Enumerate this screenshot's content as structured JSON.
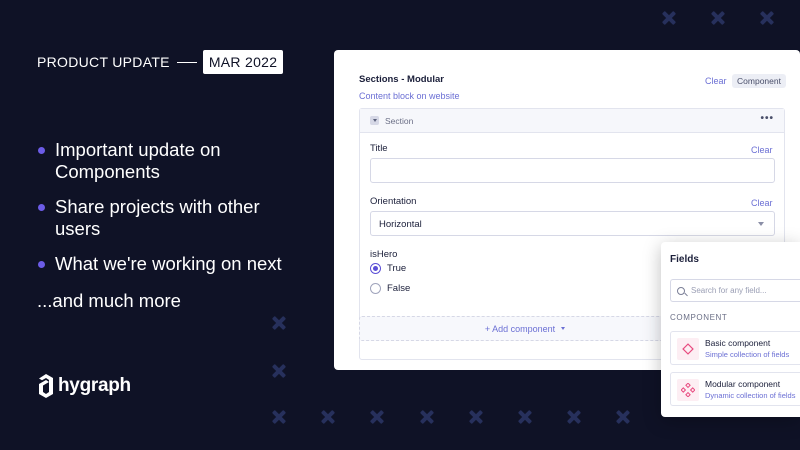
{
  "header": {
    "kicker": "PRODUCT UPDATE",
    "date": "MAR 2022"
  },
  "bullets": [
    "Important update on Components",
    "Share projects with other users",
    "What we're working on next"
  ],
  "more": "...and much more",
  "brand": {
    "name": "hygraph",
    "accent": "#6c5ce7",
    "background": "#0f1226"
  },
  "card": {
    "title": "Sections - Modular",
    "description": "Content block on website",
    "clear": "Clear",
    "badge": "Component",
    "section": {
      "label": "Section",
      "menu": "•••",
      "title_field": {
        "label": "Title",
        "clear": "Clear",
        "value": ""
      },
      "orientation_field": {
        "label": "Orientation",
        "clear": "Clear",
        "value": "Horizontal"
      },
      "ishero_field": {
        "label": "isHero",
        "options": [
          {
            "label": "True",
            "checked": true
          },
          {
            "label": "False",
            "checked": false
          }
        ]
      }
    },
    "add_component": "+ Add component"
  },
  "panel": {
    "title": "Fields",
    "search_placeholder": "Search for any field...",
    "category": "COMPONENT",
    "components": [
      {
        "name": "Basic component",
        "description": "Simple collection of fields",
        "icon": "diamond-icon"
      },
      {
        "name": "Modular component",
        "description": "Dynamic collection of fields",
        "icon": "modular-diamonds-icon"
      }
    ]
  }
}
